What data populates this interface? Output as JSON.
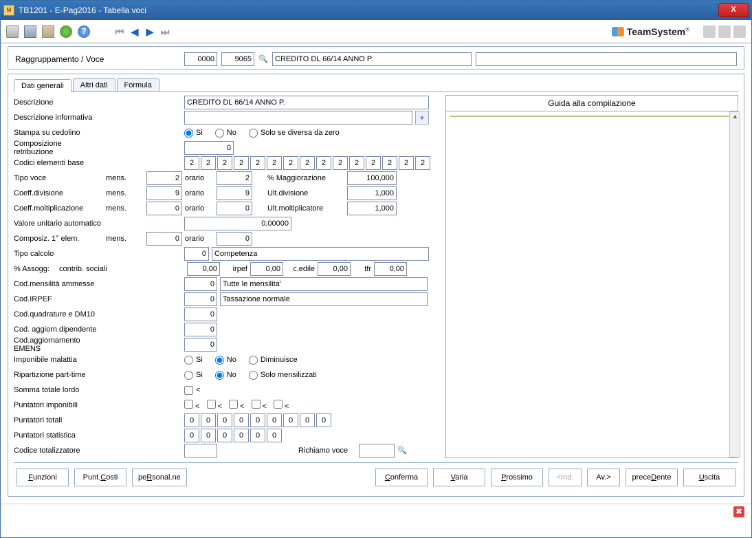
{
  "window": {
    "title": "TB1201  -  E-Pag2016  -  Tabella voci"
  },
  "brand": {
    "name": "TeamSystem"
  },
  "header": {
    "label": "Raggruppamento / Voce",
    "code1": "0000",
    "code2": "9065",
    "desc1": "CREDITO DL 66/14 ANNO P.",
    "desc2": ""
  },
  "tabs": [
    "Dati generali",
    "Altri dati",
    "Formula"
  ],
  "guide": {
    "title": "Guida alla compilazione"
  },
  "form": {
    "descrizione_lbl": "Descrizione",
    "descrizione": "CREDITO DL 66/14 ANNO P.",
    "descr_info_lbl": "Descrizione informativa",
    "descr_info": "",
    "stampa_lbl": "Stampa su cedolino",
    "stampa_opts": {
      "si": "Si",
      "no": "No",
      "solo": "Solo se diversa da zero"
    },
    "comp_retr_lbl": "Composizione retribuzione",
    "comp_retr": "0",
    "codici_lbl": "Codici elementi base",
    "codici": [
      "2",
      "2",
      "2",
      "2",
      "2",
      "2",
      "2",
      "2",
      "2",
      "2",
      "2",
      "2",
      "2",
      "2",
      "2"
    ],
    "tipo_voce_lbl": "Tipo voce",
    "mens_lbl": "mens.",
    "orario_lbl": "orario",
    "tipo_voce_mens": "2",
    "tipo_voce_orario": "2",
    "magg_lbl": "% Maggiorazione",
    "magg": "100,000",
    "coeff_div_lbl": "Coeff.divisione",
    "coeff_div_mens": "9",
    "coeff_div_orario": "9",
    "ult_div_lbl": "Ult.divisione",
    "ult_div": "1,000",
    "coeff_molt_lbl": "Coeff.moltiplicazione",
    "coeff_molt_mens": "0",
    "coeff_molt_orario": "0",
    "ult_molt_lbl": "Ult.moltiplicatore",
    "ult_molt": "1,000",
    "val_unit_lbl": "Valore unitario automatico",
    "val_unit": "0,00000",
    "compos_lbl": "Composiz. 1° elem.",
    "compos_mens": "0",
    "compos_orario": "0",
    "tipo_calc_lbl": "Tipo calcolo",
    "tipo_calc": "0",
    "tipo_calc_desc": "Competenza",
    "assogg_lbl": "% Assogg:",
    "contrib_lbl": "contrib. sociali",
    "contrib": "0,00",
    "irpef_lbl": "irpef",
    "irpef_v": "0,00",
    "cedile_lbl": "c.edile",
    "cedile": "0,00",
    "tfr_lbl": "tfr",
    "tfr": "0,00",
    "cod_mens_lbl": "Cod.mensilità ammesse",
    "cod_mens": "0",
    "cod_mens_desc": "Tutte le mensilita'",
    "cod_irpef_lbl": "Cod.IRPEF",
    "cod_irpef": "0",
    "cod_irpef_desc": "Tassazione normale",
    "cod_quad_lbl": "Cod.quadrature e DM10",
    "cod_quad": "0",
    "cod_agg_lbl": "Cod. aggiorn.dipendente",
    "cod_agg": "0",
    "cod_emens_lbl": "Cod.aggiornamento EMENS",
    "cod_emens": "0",
    "imp_mal_lbl": "Imponibile malattia",
    "imp_opts": {
      "si": "Si",
      "no": "No",
      "dim": "Diminuisce"
    },
    "rip_pt_lbl": "Ripartizione part-time",
    "rip_opts": {
      "si": "Si",
      "no": "No",
      "solo": "Solo mensilizzati"
    },
    "somma_lbl": "Somma totale lordo",
    "punt_imp_lbl": "Puntatori imponibili",
    "punt_tot_lbl": "Puntatori totali",
    "punt_tot": [
      "0",
      "0",
      "0",
      "0",
      "0",
      "0",
      "0",
      "0",
      "0"
    ],
    "punt_stat_lbl": "Puntatori statistica",
    "punt_stat": [
      "0",
      "0",
      "0",
      "0",
      "0",
      "0"
    ],
    "cod_tot_lbl": "Codice totalizzatore",
    "cod_tot": "",
    "rich_lbl": "Richiamo voce",
    "rich": "",
    "lt": "<"
  },
  "buttons": {
    "funzioni": "Funzioni",
    "puntcosti": "Punt.Costi",
    "personal": "peRsonal.ne",
    "conferma": "Conferma",
    "varia": "Varia",
    "prossimo": "Prossimo",
    "ind": "<Ind.",
    "av": "Av.>",
    "preced": "preceDente",
    "uscita": "Uscita"
  }
}
